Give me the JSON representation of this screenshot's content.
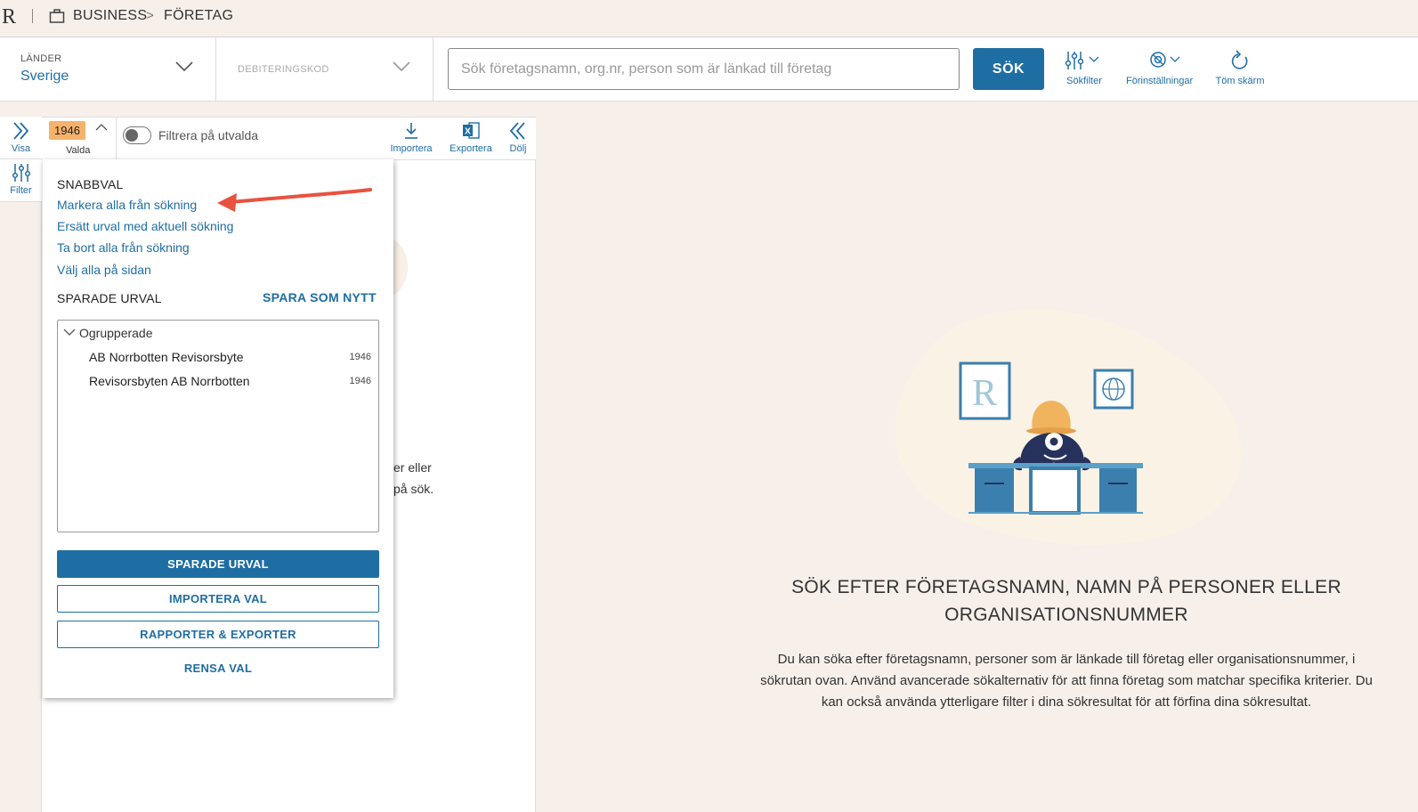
{
  "breadcrumb": {
    "logo": "R",
    "section": "BUSINESS",
    "page": "FÖRETAG"
  },
  "search_row": {
    "country_label": "LÄNDER",
    "country_value": "Sverige",
    "debit_label": "DEBITERINGSKOD",
    "search_placeholder": "Sök företagsnamn, org.nr, person som är länkad till företag",
    "search_button": "SÖK",
    "tools": {
      "filter": "Sökfilter",
      "settings": "Förinställningar",
      "clear": "Töm skärm"
    }
  },
  "rail": {
    "show": "Visa",
    "filter": "Filter"
  },
  "panel": {
    "selected_count": "1946",
    "selected_label": "Valda",
    "toggle_label": "Filtrera på utvalda",
    "import": "Importera",
    "export": "Exportera",
    "hide": "Dölj",
    "bg_text_1": "er eller",
    "bg_text_2": "på sök."
  },
  "dropdown": {
    "quick_title": "SNABBVAL",
    "quick_links": [
      "Markera alla från sökning",
      "Ersätt urval med aktuell sökning",
      "Ta bort alla från sökning",
      "Välj alla på sidan"
    ],
    "saved_title": "SPARADE URVAL",
    "save_new": "SPARA SOM NYTT",
    "group_name": "Ogrupperade",
    "items": [
      {
        "name": "AB Norrbotten Revisorsbyte",
        "count": "1946"
      },
      {
        "name": "Revisorsbyten AB Norrbotten",
        "count": "1946"
      }
    ],
    "btn_saved": "SPARADE URVAL",
    "btn_import": "IMPORTERA VAL",
    "btn_reports": "RAPPORTER & EXPORTER",
    "btn_clear": "RENSA VAL"
  },
  "empty_state": {
    "title": "SÖK EFTER FÖRETAGSNAMN, NAMN PÅ PERSONER ELLER ORGANISATIONSNUMMER",
    "description": "Du kan söka efter företagsnamn, personer som är länkade till företag eller organisationsnummer, i sökrutan ovan. Använd avancerade sökalternativ för att finna företag som matchar specifika kriterier. Du kan också använda ytterligare filter i dina sökresultat för att förfina dina sökresultat."
  },
  "colors": {
    "accent": "#1f6ea3",
    "badge": "#f5b26b",
    "background": "#f6efea",
    "arrow": "#e8523f"
  }
}
